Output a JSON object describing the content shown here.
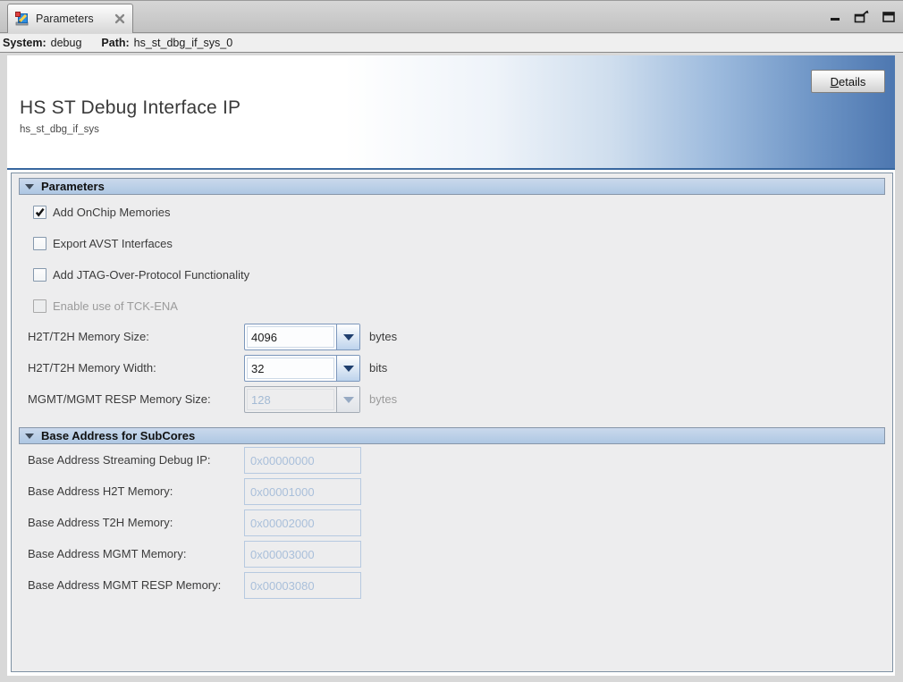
{
  "window": {
    "tab": {
      "label": "Parameters",
      "icon": "parameters-icon",
      "close_icon": "close-icon"
    },
    "controls": {
      "minimize": "minimize-icon",
      "restore": "restore-icon",
      "maximize": "maximize-icon"
    }
  },
  "infobar": {
    "system_label": "System:",
    "system_value": "debug",
    "path_label": "Path:",
    "path_value": "hs_st_dbg_if_sys_0"
  },
  "header": {
    "title": "HS ST Debug Interface IP",
    "subtitle": "hs_st_dbg_if_sys",
    "details_button": {
      "mnemonic": "D",
      "rest": "etails"
    }
  },
  "parameters_section": {
    "title": "Parameters",
    "checkboxes": [
      {
        "label": "Add OnChip Memories",
        "checked": true,
        "enabled": true
      },
      {
        "label": "Export AVST Interfaces",
        "checked": false,
        "enabled": true
      },
      {
        "label": "Add JTAG-Over-Protocol Functionality",
        "checked": false,
        "enabled": true
      },
      {
        "label": "Enable use of TCK-ENA",
        "checked": false,
        "enabled": false
      }
    ],
    "combos": [
      {
        "label": "H2T/T2H Memory Size:",
        "value": "4096",
        "unit": "bytes",
        "enabled": true
      },
      {
        "label": "H2T/T2H Memory Width:",
        "value": "32",
        "unit": "bits",
        "enabled": true
      },
      {
        "label": "MGMT/MGMT RESP Memory Size:",
        "value": "128",
        "unit": "bytes",
        "enabled": false
      }
    ]
  },
  "base_address_section": {
    "title": "Base Address for SubCores",
    "fields": [
      {
        "label": "Base Address Streaming Debug IP:",
        "value": "0x00000000",
        "enabled": false
      },
      {
        "label": "Base Address H2T Memory:",
        "value": "0x00001000",
        "enabled": false
      },
      {
        "label": "Base Address T2H Memory:",
        "value": "0x00002000",
        "enabled": false
      },
      {
        "label": "Base Address MGMT Memory:",
        "value": "0x00003000",
        "enabled": false
      },
      {
        "label": "Base Address MGMT RESP Memory:",
        "value": "0x00003080",
        "enabled": false
      }
    ]
  },
  "colors": {
    "banner_blue": "#4d77b0",
    "section_bar_blue": "#b7cce6",
    "panel_bg": "#ededee",
    "disabled_text": "#a9bfda",
    "combo_border": "#7b96bb"
  }
}
